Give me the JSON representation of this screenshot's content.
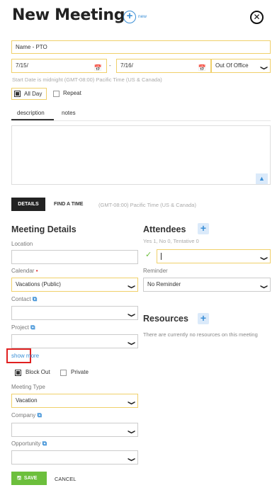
{
  "header": {
    "title": "New Meeting",
    "new_label": "new"
  },
  "form": {
    "name_value": "Name - PTO",
    "start_date": "7/15/",
    "date_separator": "-",
    "end_date": "7/16/",
    "status_value": "Out Of Office",
    "timezone_note": "Start Date is midnight (GMT-08:00) Pacific Time (US & Canada)",
    "all_day_label": "All Day",
    "repeat_label": "Repeat"
  },
  "desc_tabs": {
    "description": "description",
    "notes": "notes"
  },
  "main_tabs": {
    "details": "DETAILS",
    "find_time": "FIND A TIME",
    "timezone": "(GMT-08:00) Pacific Time (US & Canada)"
  },
  "details": {
    "heading": "Meeting Details",
    "location_label": "Location",
    "location_value": "",
    "calendar_label": "Calendar",
    "required_mark": "•",
    "calendar_value": "Vacations (Public)",
    "contact_label": "Contact",
    "contact_value": "",
    "project_label": "Project",
    "project_value": "",
    "show_more": "show more",
    "block_out_label": "Block Out",
    "private_label": "Private",
    "meeting_type_label": "Meeting Type",
    "meeting_type_value": "Vacation",
    "company_label": "Company",
    "company_value": "",
    "opportunity_label": "Opportunity",
    "opportunity_value": ""
  },
  "attendees": {
    "heading": "Attendees",
    "summary": "Yes 1, No 0, Tentative 0",
    "reminder_label": "Reminder",
    "reminder_value": "No Reminder"
  },
  "resources": {
    "heading": "Resources",
    "empty_text": "There are currently no resources on this meeting"
  },
  "footer": {
    "save_label": "SAVE",
    "cancel_label": "CANCEL"
  },
  "colors": {
    "accent": "#3b8fd6",
    "save_green": "#6cbf3c",
    "highlight_border": "#f0d06a",
    "callout_red": "#e02020"
  }
}
